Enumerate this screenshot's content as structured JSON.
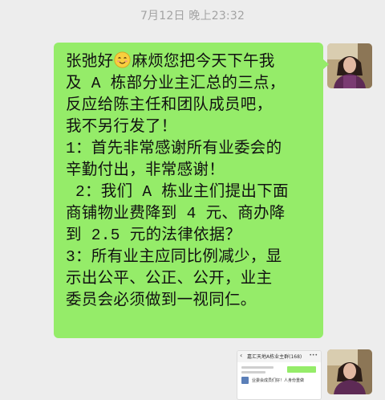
{
  "chat": {
    "timestamp": "7月12日 晚上23:32",
    "message": {
      "lines": [
        "张弛好",
        "麻烦您把今天下午我",
        "及 A 栋部分业主汇总的三点，",
        "反应给陈主任和团队成员吧，",
        "我不另行发了！",
        "1：首先非常感谢所有业委会的",
        "辛勤付出，非常感谢！",
        " 2：我们 A 栋业主们提出下面",
        "商铺物业费降到 4 元、商办降",
        "到 2.5 元的法律依据？",
        "3：所有业主应同比例减少，显",
        "示出公平、公正、公开，业主",
        "委员会必须做到一视同仁。"
      ],
      "emoji": "smiling-face-icon"
    },
    "image_message": {
      "title": "嘉汇天地A栋业主群(168)",
      "snippet": "业委会成员们好！人身份重做"
    },
    "colors": {
      "bubble": "#95ec69",
      "background": "#ededed"
    }
  }
}
